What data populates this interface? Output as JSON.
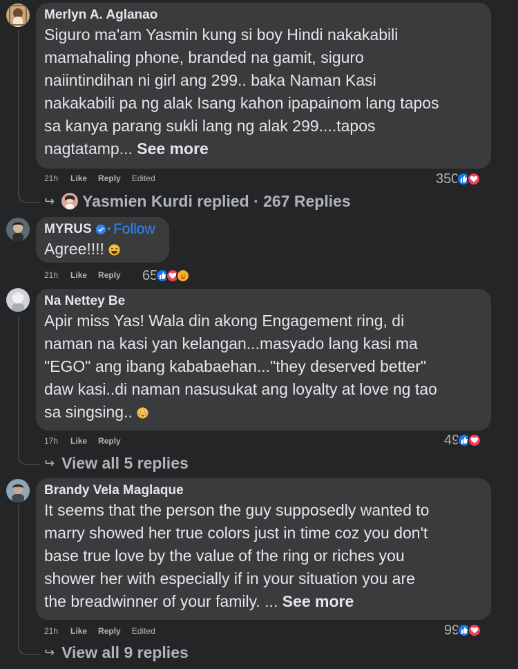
{
  "comments": [
    {
      "author": "Merlyn A. Aglanao",
      "text": "Siguro ma'am Yasmin kung si boy Hindi nakakabili\nmamahaling phone, branded na gamit, siguro\nnaiintindihan ni girl ang 299.. baka Naman Kasi\nnakakabili pa ng alak Isang kahon ipapainom lang tapos\nsa kanya parang sukli lang ng alak 299....tapos\nnagtatamp... ",
      "see_more": "See more",
      "time": "21h",
      "like": "Like",
      "reply": "Reply",
      "edited": "Edited",
      "reaction_count": "350",
      "replies": {
        "replier": "Yasmien Kurdi",
        "replied_label": "replied",
        "separator": "·",
        "count_label": "267 Replies"
      }
    },
    {
      "author": "MYRUS",
      "follow_dot": "·",
      "follow": "Follow",
      "text": "Agree!!!!",
      "time": "21h",
      "like": "Like",
      "reply": "Reply",
      "reaction_count": "65"
    },
    {
      "author": "Na Nettey Be",
      "text": "Apir miss Yas! Wala din akong Engagement ring, di\nnaman na kasi yan kelangan...masyado lang kasi ma\n\"EGO\" ang ibang kababaehan...\"they deserved better\"\ndaw kasi..di naman nasusukat ang loyalty at love ng tao\nsa singsing..",
      "time": "17h",
      "like": "Like",
      "reply": "Reply",
      "reaction_count": "49",
      "view_replies": "View all 5 replies"
    },
    {
      "author": "Brandy Vela Maglaque",
      "text": "It seems that the person the guy supposedly wanted to\nmarry showed her true colors just in time coz you don't\nbase true love by the value of the ring or riches you\nshower her with especially if in your situation you are\nthe breadwinner of your family. ... ",
      "see_more": "See more",
      "time": "21h",
      "like": "Like",
      "reply": "Reply",
      "edited": "Edited",
      "reaction_count": "99",
      "view_replies": "View all 9 replies"
    }
  ],
  "colors": {
    "background": "#242526",
    "bubble": "#3a3b3c",
    "text": "#e4e6eb",
    "secondary": "#b0b3b8",
    "link": "#2d88ff",
    "like_blue": "#1877f2",
    "love_red": "#f33e58",
    "care_yellow": "#f7b125"
  },
  "icons": [
    "like-reaction-icon",
    "love-reaction-icon",
    "care-reaction-icon",
    "verified-badge-icon",
    "reply-arrow-icon",
    "laughing-emoji-icon",
    "flushed-emoji-icon"
  ]
}
